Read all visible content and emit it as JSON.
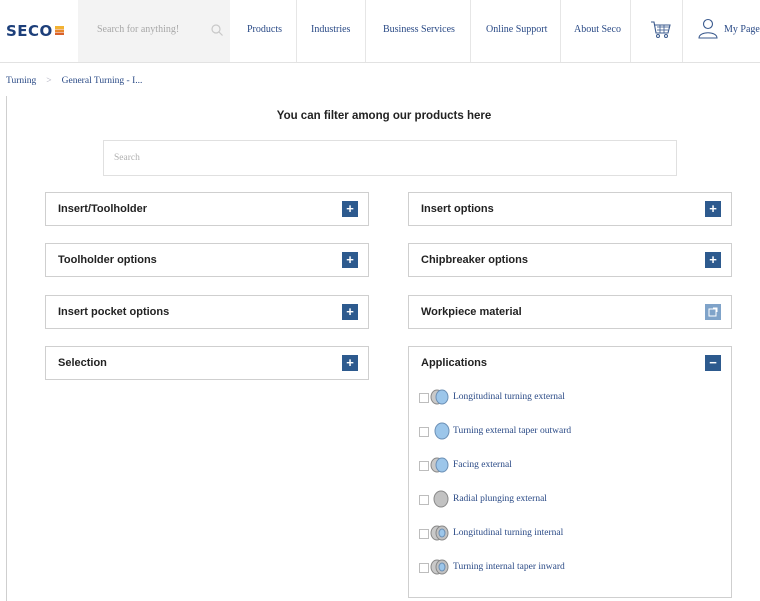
{
  "header": {
    "logo_text": "SECO",
    "search_placeholder": "Search for anything!",
    "nav": [
      "Products",
      "Industries",
      "Business Services",
      "Online Support",
      "About Seco"
    ],
    "cart_icon": "cart-icon",
    "account_label": "My Pages",
    "brand_color": "#1d3f7a"
  },
  "breadcrumb": {
    "items": [
      "Turning",
      "General Turning - I..."
    ]
  },
  "filters": {
    "heading": "You can filter among our products here",
    "search_placeholder": "Search",
    "left_panels": [
      "Insert/Toolholder",
      "Toolholder options",
      "Insert pocket options",
      "Selection"
    ],
    "right_panels": [
      "Insert options",
      "Chipbreaker options",
      "Workpiece material"
    ],
    "applications": {
      "title": "Applications",
      "items": [
        "Longitudinal turning external",
        "Turning external taper outward",
        "Facing external",
        "Radial plunging external",
        "Longitudinal turning internal",
        "Turning internal taper inward"
      ]
    },
    "accent_color": "#2d5a8e",
    "expand_symbol": "+",
    "collapse_symbol": "−"
  }
}
